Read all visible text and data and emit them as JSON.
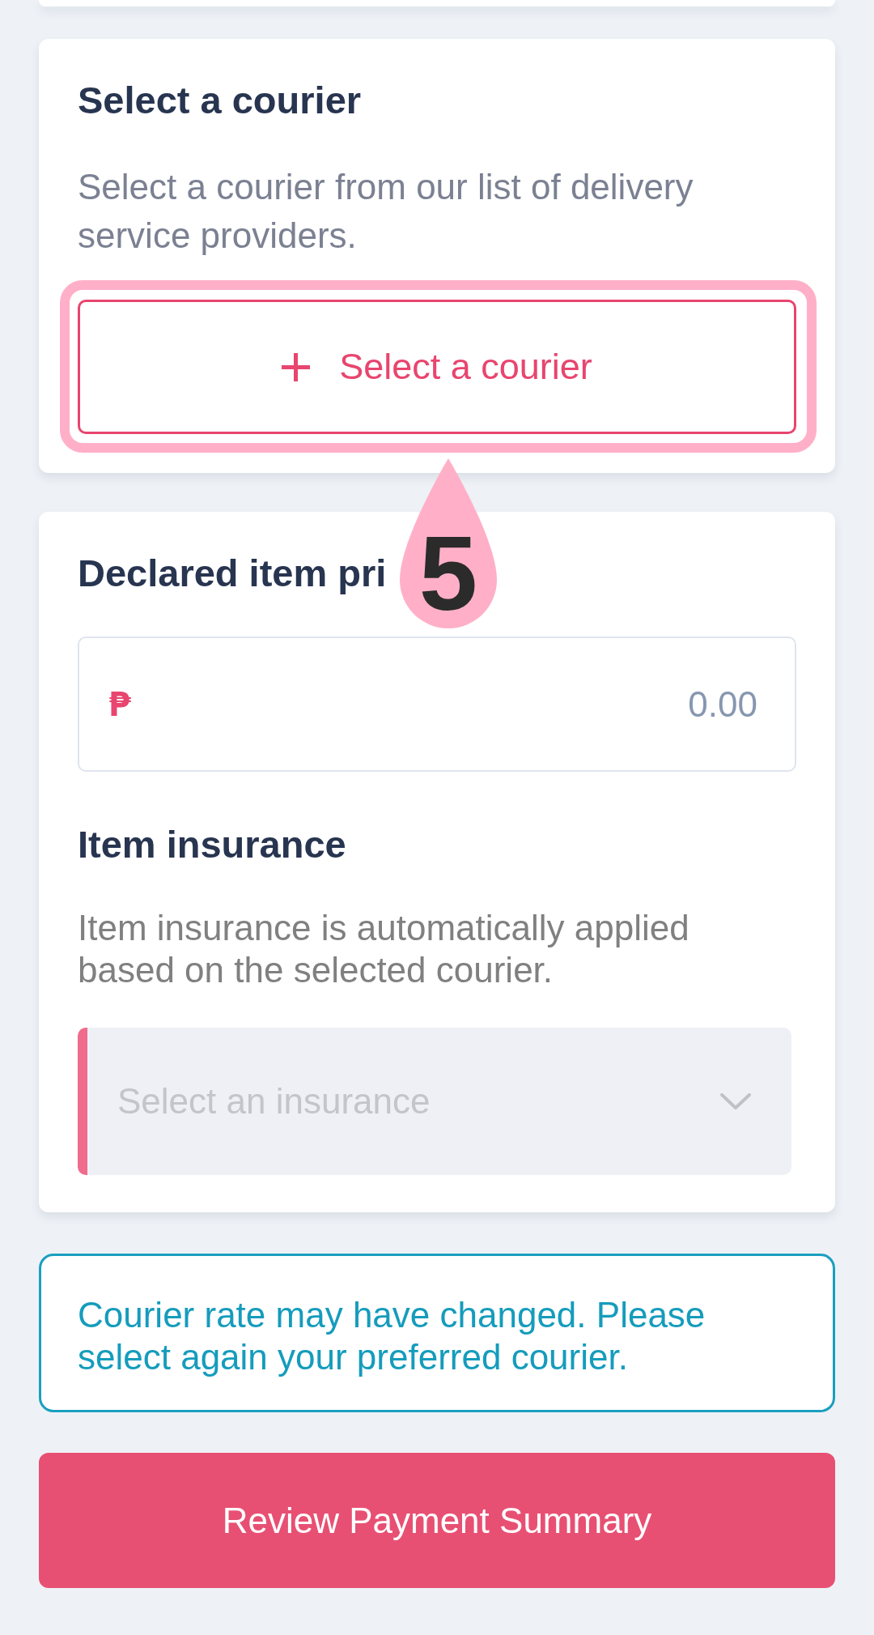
{
  "courier_section": {
    "title": "Select a courier",
    "description": "Select a courier from our list of delivery service providers.",
    "button": {
      "label": "Select a courier",
      "highlighted": true
    }
  },
  "price_section": {
    "title": "Declared item pri",
    "currency": "₱",
    "placeholder": "0.00"
  },
  "insurance_section": {
    "title": "Item insurance",
    "description": "Item insurance is automatically applied based on the selected courier.",
    "select": {
      "placeholder": "Select an insurance",
      "invalid": true
    }
  },
  "notice": "Courier rate may have changed. Please select again your preferred courier.",
  "primary_button": "Review Payment Summary",
  "step_marker": {
    "label": "5"
  }
}
